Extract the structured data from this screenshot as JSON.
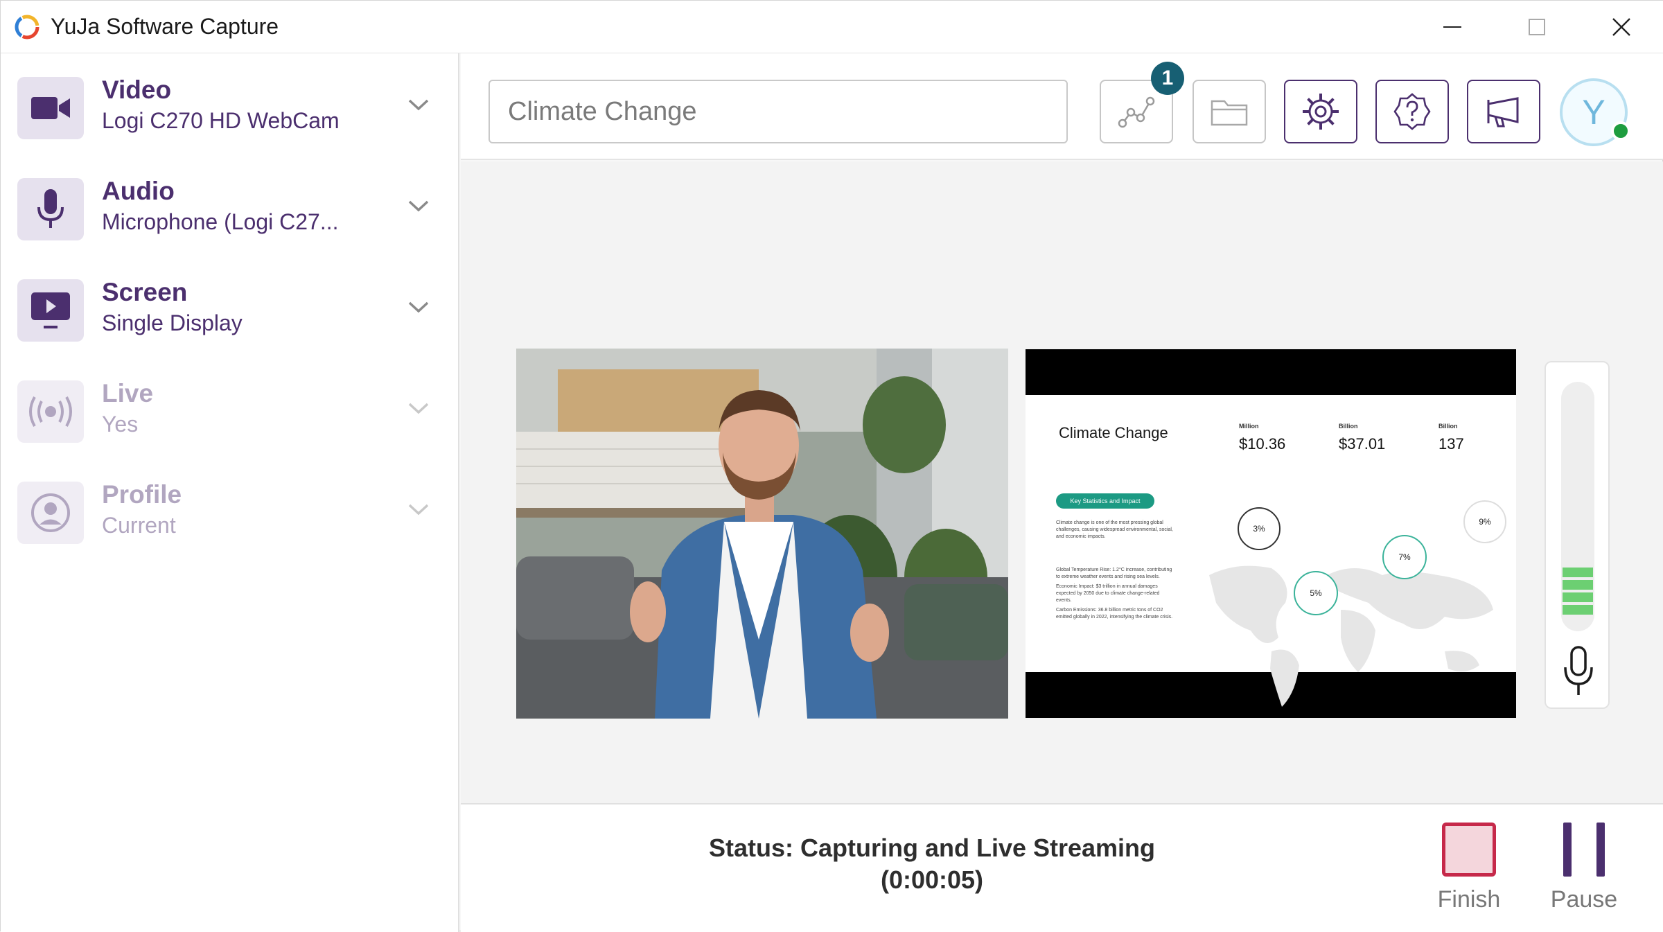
{
  "window": {
    "title": "YuJa Software Capture"
  },
  "sidebar": {
    "items": [
      {
        "title": "Video",
        "subtitle": "Logi C270 HD WebCam",
        "icon": "video-camera-icon",
        "enabled": true
      },
      {
        "title": "Audio",
        "subtitle": "Microphone (Logi C27...",
        "icon": "microphone-icon",
        "enabled": true
      },
      {
        "title": "Screen",
        "subtitle": "Single Display",
        "icon": "screen-play-icon",
        "enabled": true
      },
      {
        "title": "Live",
        "subtitle": "Yes",
        "icon": "broadcast-icon",
        "enabled": false
      },
      {
        "title": "Profile",
        "subtitle": "Current",
        "icon": "profile-icon",
        "enabled": false
      }
    ]
  },
  "toolbar": {
    "title_value": "Climate Change",
    "badge_count": "1",
    "avatar_letter": "Y",
    "icons": [
      "analytics-icon",
      "folder-icon",
      "settings-gear-icon",
      "help-icon",
      "announcement-icon"
    ]
  },
  "slide": {
    "title": "Climate Change",
    "stats": [
      {
        "label": "Million",
        "value": "$10.36"
      },
      {
        "label": "Billion",
        "value": "$37.01"
      },
      {
        "label": "Billion",
        "value": "137"
      }
    ],
    "pill": "Key Statistics and Impact",
    "intro": "Climate change is one of the most pressing global challenges, causing widespread environmental, social, and economic impacts.",
    "bullets": [
      "Global Temperature Rise: 1.2°C increase, contributing to extreme weather events and rising sea levels.",
      "Economic Impact: $3 trillion in annual damages expected by 2050 due to climate change-related events.",
      "Carbon Emissions: 36.8 billion metric tons of CO2 emitted globally in 2022, intensifying the climate crisis."
    ],
    "circles": [
      "3%",
      "9%",
      "7%",
      "5%"
    ]
  },
  "audio_meter": {
    "level_fraction": 0.18
  },
  "status": {
    "line1": "Status: Capturing and Live Streaming",
    "line2": "(0:00:05)"
  },
  "controls": {
    "finish_label": "Finish",
    "pause_label": "Pause"
  },
  "colors": {
    "accent": "#4b2f6e",
    "disabled": "#b1a6c0",
    "badge": "#175f73",
    "finish": "#c6294a",
    "meter_green": "#6ccf72"
  }
}
